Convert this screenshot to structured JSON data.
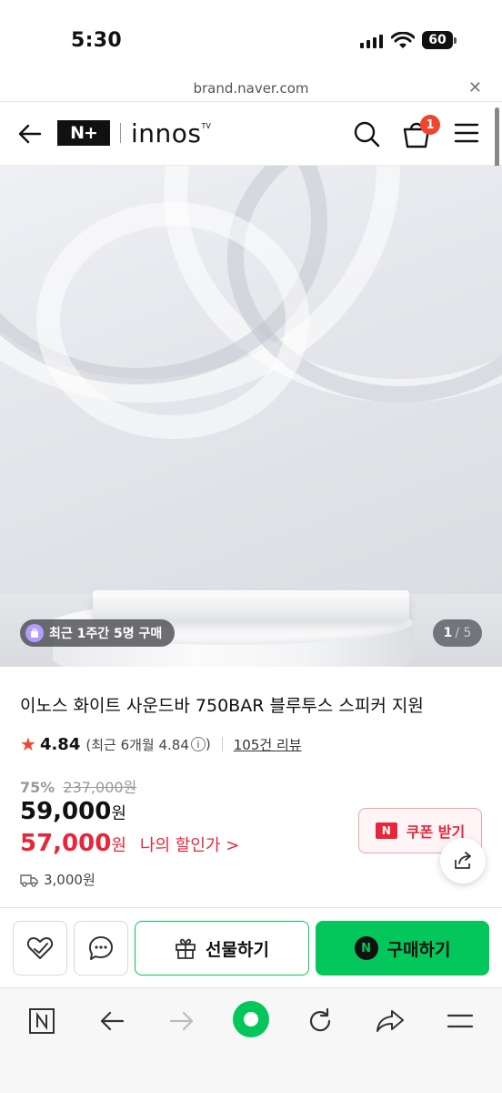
{
  "status_bar": {
    "time": "5:30",
    "battery": "60"
  },
  "url_bar": {
    "url": "brand.naver.com",
    "close_icon": "close-icon"
  },
  "header": {
    "nplus_logo": "N+",
    "brand_name": "innos",
    "brand_sup": "TV",
    "cart_count": "1",
    "icons": [
      "back-arrow-icon",
      "search-icon",
      "cart-icon",
      "hamburger-menu-icon"
    ]
  },
  "hero": {
    "purchase_badge": "최근 1주간 5명 구매",
    "image_index": "1",
    "image_total": "/ 5"
  },
  "product": {
    "title": "이노스 화이트 사운드바 750BAR 블루투스 스피커 지원",
    "rating": "4.84",
    "rating_recent": "(최근 6개월 4.84",
    "rating_close": ")",
    "review_link": "105건 리뷰",
    "discount_pct": "75%",
    "original_price": "237,000원",
    "price": "59,000",
    "price_unit": "원",
    "my_price": "57,000",
    "my_price_unit": "원",
    "my_price_link": "나의 할인가 >",
    "coupon_logo": "N",
    "coupon_label": "쿠폰 받기",
    "shipping_fee": "3,000원"
  },
  "action_bar": {
    "gift_label": "선물하기",
    "buy_label": "구매하기",
    "buy_logo": "N"
  },
  "toolbar": {
    "icons": [
      "naver-home-icon",
      "back-icon",
      "forward-icon",
      "green-dot-icon",
      "reload-icon",
      "share-icon",
      "menu-icon"
    ]
  },
  "colors": {
    "naver_green": "#03c75a",
    "discount_red": "#e8263a",
    "star_red": "#f0452d"
  }
}
